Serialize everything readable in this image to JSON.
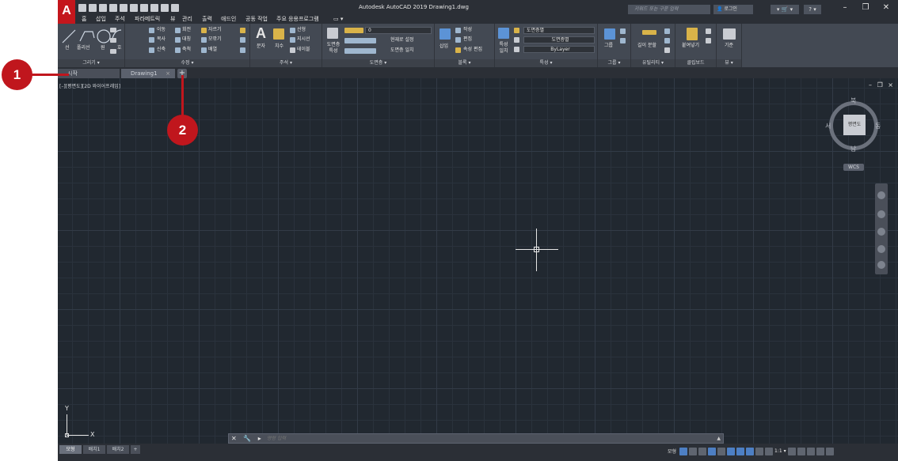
{
  "app": {
    "title": "Autodesk AutoCAD 2019    Drawing1.dwg",
    "logo_letter": "A",
    "search_placeholder": "키워드 또는 구문 입력",
    "login_label": "로그인",
    "cart_label": "▾ 🛒 ▾",
    "help_label": "? ▾",
    "window_controls": [
      "–",
      "❐",
      "✕"
    ]
  },
  "menu_tabs": [
    "홈",
    "삽입",
    "주석",
    "파라메트릭",
    "뷰",
    "관리",
    "출력",
    "애드인",
    "공동 작업",
    "주요 응용프로그램"
  ],
  "ribbon": {
    "draw": {
      "title": "그리기 ▾",
      "tools": [
        "선",
        "폴리선",
        "원",
        "호"
      ]
    },
    "modify": {
      "title": "수정 ▾",
      "tools": [
        "이동",
        "회전",
        "자르기",
        "복사",
        "대칭",
        "모깎기",
        "신축",
        "축척",
        "배열"
      ]
    },
    "annotation": {
      "title": "주석 ▾",
      "tools": [
        "문자",
        "치수",
        "선형",
        "지시선",
        "테이블"
      ]
    },
    "layers": {
      "title": "도면층 ▾",
      "tools": [
        "도면층 특성",
        "현재로 설정",
        "도면층 일치"
      ],
      "layer_value": "0"
    },
    "block": {
      "title": "블록 ▾",
      "tools": [
        "삽입",
        "작성",
        "편집",
        "속성 편집"
      ]
    },
    "properties": {
      "title": "특성 ▾",
      "match_label": "특성 일치",
      "color_value": "도면층별",
      "linetype_value": "도면층별",
      "lineweight_value": "ByLayer"
    },
    "groups": {
      "title": "그룹 ▾",
      "tools": [
        "그룹"
      ]
    },
    "utilities": {
      "title": "유틸리티 ▾",
      "tools": [
        "길이 분할"
      ]
    },
    "clipboard": {
      "title": "클립보드",
      "tools": [
        "붙여넣기"
      ]
    },
    "view": {
      "title": "뷰 ▾",
      "tools": [
        "기준"
      ]
    }
  },
  "file_tabs": [
    {
      "label": "시작",
      "active": false
    },
    {
      "label": "Drawing1",
      "active": true
    }
  ],
  "tab_close": "×",
  "tab_add": "+",
  "viewport": {
    "label": "[–][평면도][2D 와이어프레임]",
    "controls": "– ❐ ×"
  },
  "viewcube": {
    "north": "북",
    "south": "남",
    "east": "동",
    "west": "서",
    "face": "평면도",
    "wcs": "WCS"
  },
  "ucs": {
    "x": "X",
    "y": "Y"
  },
  "command_line": {
    "placeholder": "명령 입력",
    "buttons": "✕ 🔧 ▸"
  },
  "layout_tabs": [
    {
      "label": "모형",
      "active": true
    },
    {
      "label": "배치1",
      "active": false
    },
    {
      "label": "배치2",
      "active": false
    },
    {
      "label": "+",
      "active": false
    }
  ],
  "status": {
    "model_label": "모형",
    "scale": "1:1 ▾"
  },
  "callouts": [
    "1",
    "2"
  ],
  "colors": {
    "canvas": "#212830",
    "grid_major": "#323b47",
    "callout": "#c0161d",
    "logo": "#c4161c"
  }
}
